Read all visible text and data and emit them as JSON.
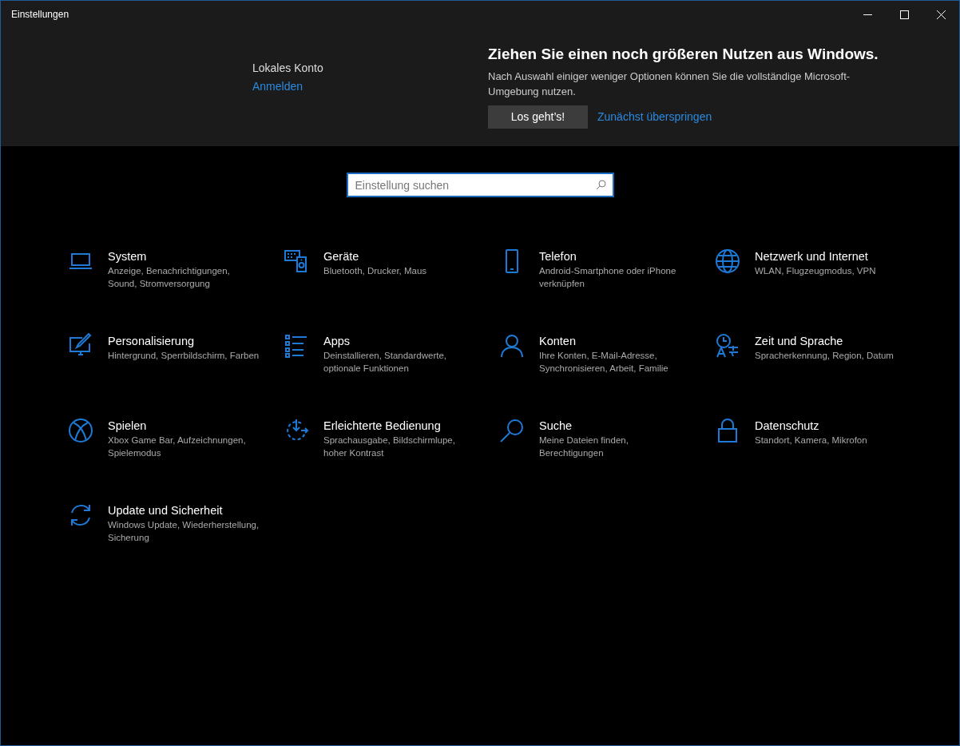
{
  "window": {
    "title": "Einstellungen"
  },
  "account": {
    "name": "Lokales Konto",
    "link": "Anmelden"
  },
  "promo": {
    "heading": "Ziehen Sie einen noch größeren Nutzen aus Windows.",
    "text": "Nach Auswahl einiger weniger Optionen können Sie die vollständige Microsoft-Umgebung nutzen.",
    "button": "Los geht’s!",
    "link": "Zunächst überspringen"
  },
  "search": {
    "placeholder": "Einstellung suchen"
  },
  "categories": [
    {
      "title": "System",
      "description": "Anzeige, Benachrichtigungen, Sound, Stromversorgung"
    },
    {
      "title": "Geräte",
      "description": "Bluetooth, Drucker, Maus"
    },
    {
      "title": "Telefon",
      "description": "Android-Smartphone oder iPhone verknüpfen"
    },
    {
      "title": "Netzwerk und Internet",
      "description": "WLAN, Flugzeugmodus, VPN"
    },
    {
      "title": "Personalisierung",
      "description": "Hintergrund, Sperrbildschirm, Farben"
    },
    {
      "title": "Apps",
      "description": "Deinstallieren, Standardwerte, optionale Funktionen"
    },
    {
      "title": "Konten",
      "description": "Ihre Konten, E-Mail-Adresse, Synchronisieren, Arbeit, Familie"
    },
    {
      "title": "Zeit und Sprache",
      "description": "Spracherkennung, Region, Datum"
    },
    {
      "title": "Spielen",
      "description": "Xbox Game Bar, Aufzeichnungen, Spielemodus"
    },
    {
      "title": "Erleichterte Bedienung",
      "description": "Sprachausgabe, Bildschirmlupe, hoher Kontrast"
    },
    {
      "title": "Suche",
      "description": "Meine Dateien finden, Berechtigungen"
    },
    {
      "title": "Datenschutz",
      "description": "Standort, Kamera, Mikrofon"
    },
    {
      "title": "Update und Sicherheit",
      "description": "Windows Update, Wiederherstellung, Sicherung"
    }
  ]
}
